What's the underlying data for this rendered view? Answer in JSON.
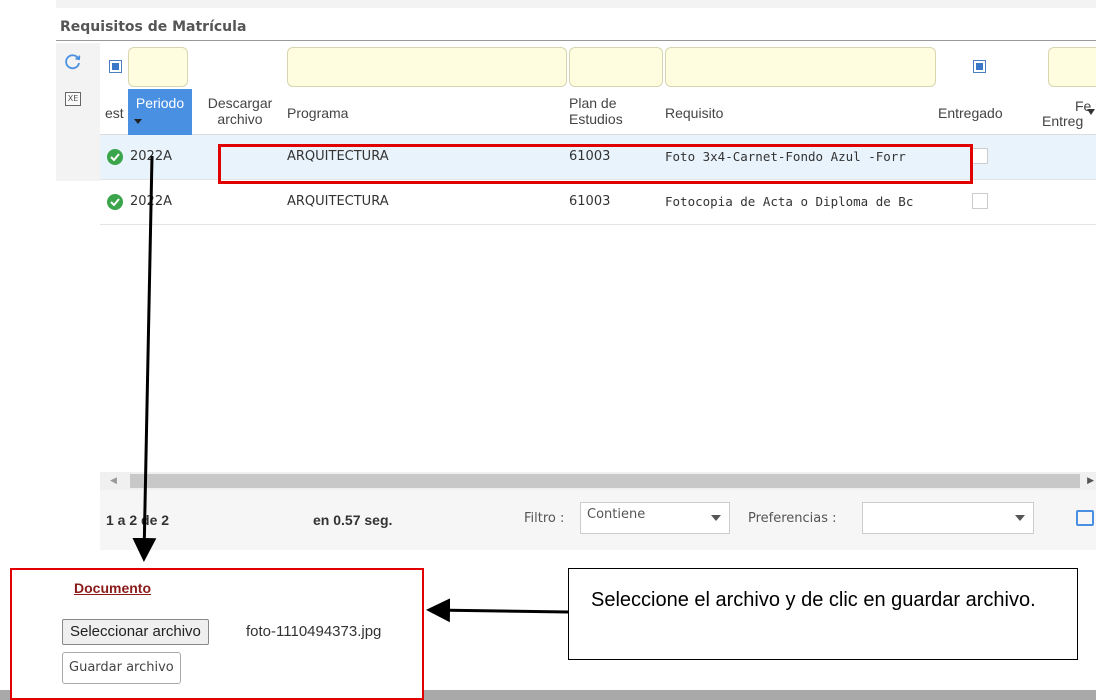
{
  "section": {
    "title": "Requisitos de Matrícula"
  },
  "colors": {
    "accent": "#4a90e2",
    "highlight": "#e00000",
    "filter_bg": "#fffde0",
    "ok": "#3aa54a"
  },
  "toolbar": {
    "refresh_icon": "refresh-icon",
    "export_icon": "xe-icon",
    "export_label": "XE"
  },
  "headers": {
    "estado": "est",
    "periodo": "Periodo",
    "descargar": "Descargar archivo",
    "programa": "Programa",
    "plan": "Plan de Estudios",
    "requisito": "Requisito",
    "entregado": "Entregado",
    "fecha": "Fe",
    "fecha2": "Entreg"
  },
  "rows": [
    {
      "periodo": "2022A",
      "programa": "ARQUITECTURA",
      "plan": "61003",
      "requisito": "Foto 3x4-Carnet-Fondo Azul -Forr",
      "selected": true
    },
    {
      "periodo": "2022A",
      "programa": "ARQUITECTURA",
      "plan": "61003",
      "requisito": "Fotocopia de Acta o Diploma de Bc",
      "selected": false
    }
  ],
  "pager": {
    "count": "1 a 2 de 2",
    "time": "en 0.57 seg.",
    "filtro_label": "Filtro :",
    "filtro_value": "Contiene",
    "pref_label": "Preferencias :",
    "pref_value": ""
  },
  "document": {
    "title": "Documento",
    "select_button": "Seleccionar archivo",
    "file_name": "foto-1110494373.jpg",
    "save_button": "Guardar archivo"
  },
  "callout": {
    "text": "Seleccione el archivo y de clic en guardar archivo."
  }
}
